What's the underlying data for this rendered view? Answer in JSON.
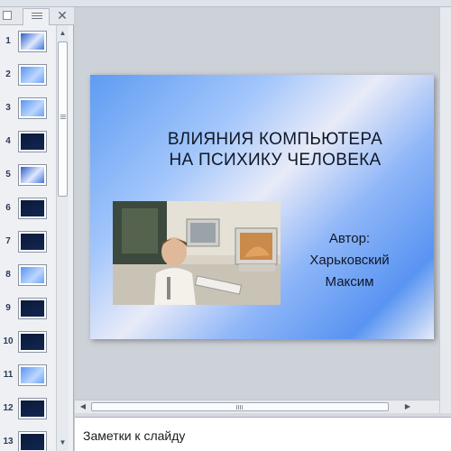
{
  "left_panel": {
    "tabs": {
      "slides_icon": "slides-tab-icon",
      "outline_icon": "outline-tab-icon",
      "close_icon": "close-icon"
    },
    "thumbnails": [
      {
        "number": "1",
        "style": "th-img"
      },
      {
        "number": "2",
        "style": "th-blue"
      },
      {
        "number": "3",
        "style": "th-blue"
      },
      {
        "number": "4",
        "style": "th-dark"
      },
      {
        "number": "5",
        "style": "th-img"
      },
      {
        "number": "6",
        "style": "th-dark"
      },
      {
        "number": "7",
        "style": "th-dark"
      },
      {
        "number": "8",
        "style": "th-blue"
      },
      {
        "number": "9",
        "style": "th-dark"
      },
      {
        "number": "10",
        "style": "th-dark"
      },
      {
        "number": "11",
        "style": "th-blue"
      },
      {
        "number": "12",
        "style": "th-dark"
      },
      {
        "number": "13",
        "style": "th-dark"
      }
    ]
  },
  "slide": {
    "title_line1": "ВЛИЯНИЯ КОМПЬЮТЕРА",
    "title_line2": "НА ПСИХИКУ ЧЕЛОВЕКА",
    "author_label": "Автор:",
    "author_name_line1": "Харьковский",
    "author_name_line2": "Максим"
  },
  "notes": {
    "placeholder": "Заметки к слайду"
  },
  "colors": {
    "slide_gradient_start": "#5e9cf2",
    "slide_gradient_light": "#e8ebf8",
    "title_text": "#101827"
  }
}
